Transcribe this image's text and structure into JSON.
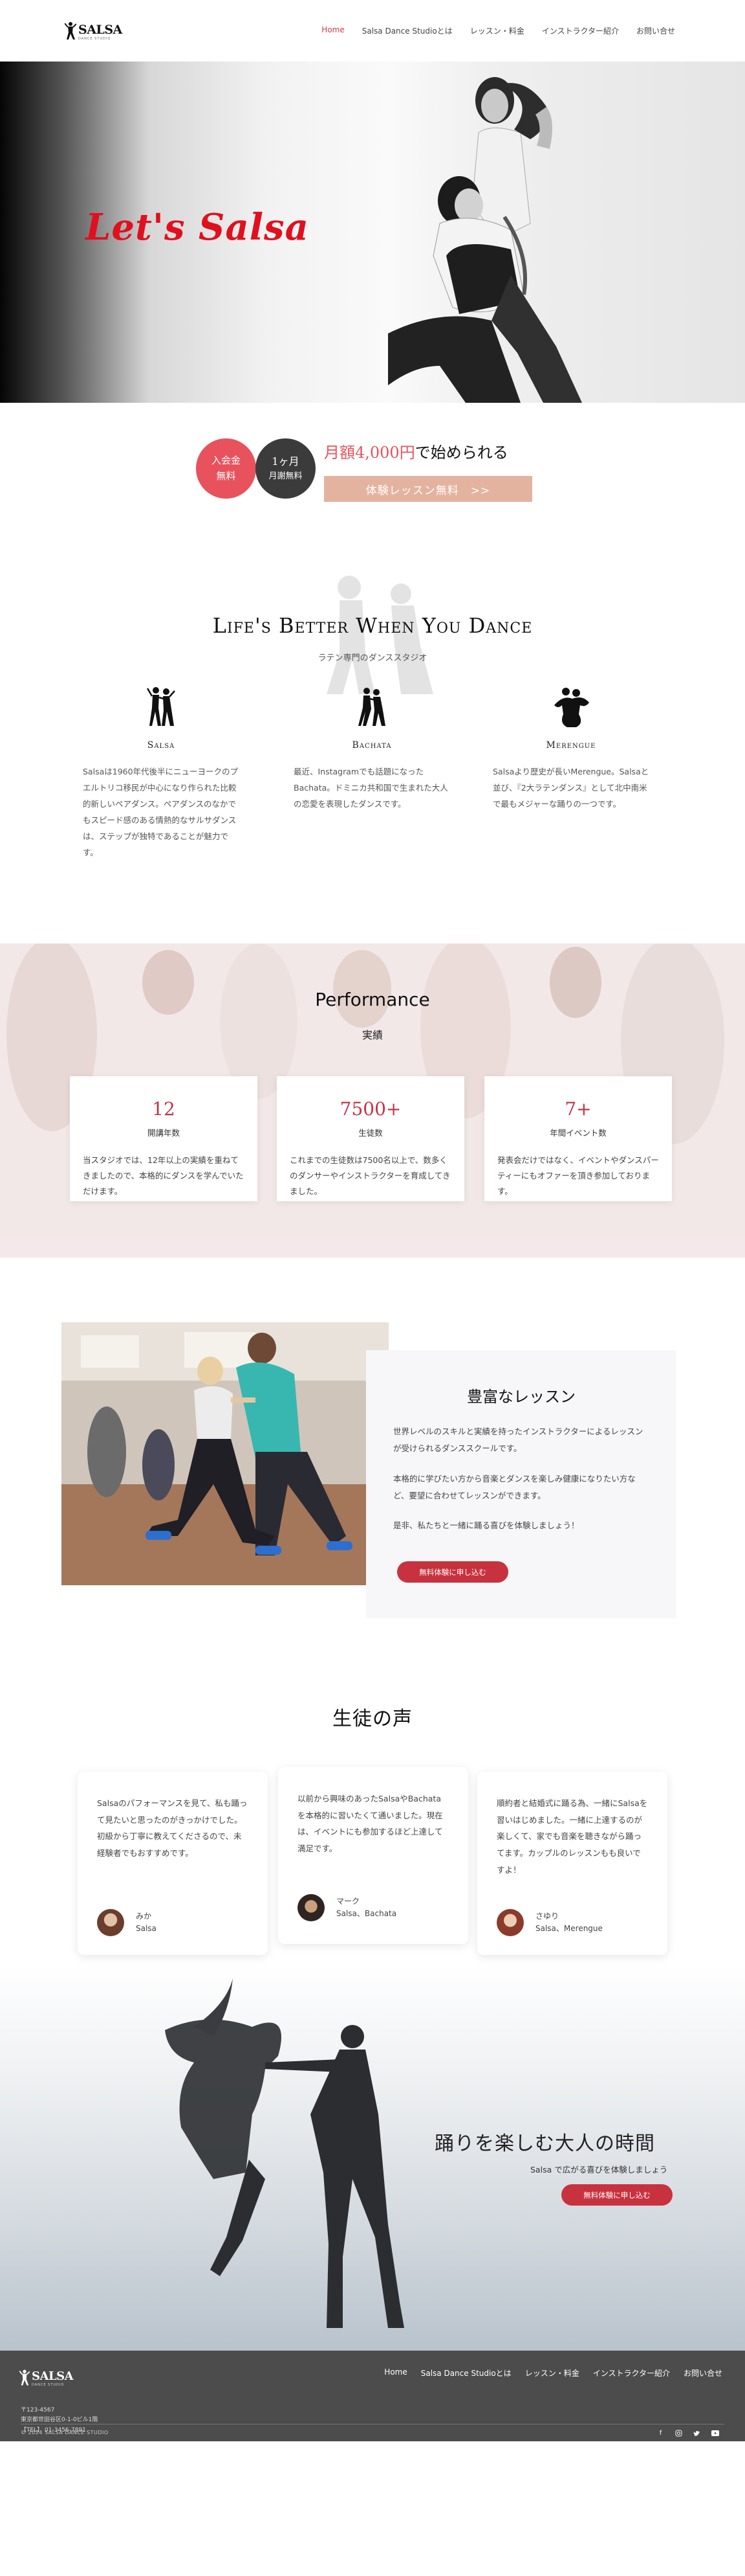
{
  "header": {
    "logo_text": "SALSA",
    "logo_sub": "DANCE STUDIO",
    "nav": [
      "Home",
      "Salsa Dance Studioとは",
      "レッスン・料金",
      "インストラクター紹介",
      "お問い合せ"
    ]
  },
  "hero": {
    "title": "Let's Salsa"
  },
  "offer": {
    "badge1": [
      "入会金",
      "無料"
    ],
    "badge2": [
      "1ヶ月",
      "月謝無料"
    ],
    "price_pre": "月額4,000円",
    "price_post": "で始められる",
    "button": "体験レッスン無料　>>"
  },
  "styles": {
    "title": "Life's Better When You Dance",
    "subtitle": "ラテン専門のダンススタジオ",
    "items": [
      {
        "name": "Salsa",
        "desc": "Salsaは1960年代後半にニューヨークのプエルトリコ移民が中心になり作られた比較的新しいペアダンス。ペアダンスのなかでもスピード感のある情熱的なサルサダンスは、ステップが独特であることが魅力です。"
      },
      {
        "name": "Bachata",
        "desc": "最近、Instagramでも話題になったBachata。ドミニカ共和国で生まれた大人の恋愛を表現したダンスです。"
      },
      {
        "name": "Merengue",
        "desc": "Salsaより歴史が長いMerengue。Salsaと並び、『2大ラテンダンス』として北中南米で最もメジャーな踊りの一つです。"
      }
    ]
  },
  "performance": {
    "title": "Performance",
    "subtitle": "実績",
    "stats": [
      {
        "num": "12",
        "label": "開講年数",
        "desc": "当スタジオでは、12年以上の実績を重ねてきましたので、本格的にダンスを学んでいただけます。"
      },
      {
        "num": "7500+",
        "label": "生徒数",
        "desc": "これまでの生徒数は7500名以上で、数多くのダンサーやインストラクターを育成してきました。"
      },
      {
        "num": "7+",
        "label": "年間イベント数",
        "desc": "発表会だけではなく、イベントやダンスパーティーにもオファーを頂き参加しております。"
      }
    ]
  },
  "lessons": {
    "title": "豊富なレッスン",
    "paragraphs": [
      "世界レベルのスキルと実績を持ったインストラクターによるレッスンが受けられるダンススクールです。",
      "本格的に学びたい方から音楽とダンスを楽しみ健康になりたい方など、要望に合わせてレッスンができます。",
      "是非、私たちと一緒に踊る喜びを体験しましょう！"
    ],
    "button": "無料体験に申し込む"
  },
  "voices": {
    "title": "生徒の声",
    "items": [
      {
        "text": "Salsaのパフォーマンスを見て、私も踊って見たいと思ったのがきっかけでした。初級から丁寧に教えてくださるので、未経験者でもおすすめです。",
        "name": "みか",
        "style": "Salsa"
      },
      {
        "text": "以前から興味のあったSalsaやBachataを本格的に習いたくて通いました。現在は、イベントにも参加するほど上達して満足です。",
        "name": "マーク",
        "style": "Salsa、Bachata"
      },
      {
        "text": "順約者と結婚式に踊る為、一緒にSalsaを習いはじめました。一緒に上達するのが楽しくて、家でも音楽を聴きながら踊ってます。カップルのレッスンもも良いですよ！",
        "name": "さゆり",
        "style": "Salsa、Merengue"
      }
    ]
  },
  "cta": {
    "title": "踊りを楽しむ大人の時間",
    "subtitle": "Salsa で広がる喜びを体験しましょう",
    "button": "無料体験に申し込む"
  },
  "footer": {
    "logo_text": "SALSA",
    "logo_sub": "DANCE STUDIO",
    "address": [
      "〒123-4567",
      "東京都世田谷区0-1-0ビル1階",
      "【TEL】 01-3456-7891"
    ],
    "nav": [
      "Home",
      "Salsa Dance Studioとは",
      "レッスン・料金",
      "インストラクター紹介",
      "お問い合せ"
    ],
    "copyright": "© 2024 SALSA DANCE STUDIO",
    "social": [
      "facebook-icon",
      "instagram-icon",
      "twitter-icon",
      "youtube-icon"
    ]
  },
  "colors": {
    "accent": "#c8323f",
    "hero_title": "#e0101e",
    "badge_red": "#e8525c",
    "badge_dark": "#3b3b3b",
    "trial_button": "#e4b39f",
    "footer_bg": "#4c4c4c"
  }
}
